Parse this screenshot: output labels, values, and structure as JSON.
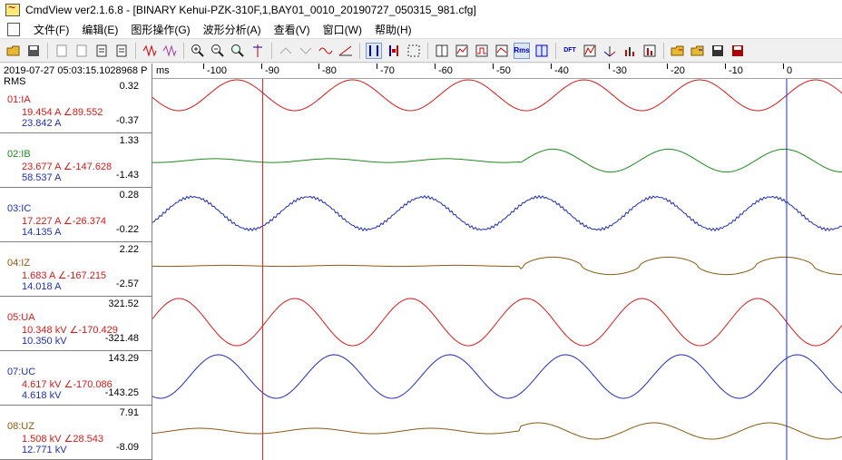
{
  "window": {
    "title": "CmdView ver2.1.6.8 - [BINARY Kehui-PZK-310F,1,BAY01_0010_20190727_050315_981.cfg]"
  },
  "menu": [
    "文件(F)",
    "编辑(E)",
    "图形操作(G)",
    "波形分析(A)",
    "查看(V)",
    "窗口(W)",
    "帮助(H)"
  ],
  "toolbar": {
    "icons": [
      "open-icon",
      "save-icon",
      "doc1-icon",
      "doc2-icon",
      "doc3-icon",
      "doc4-icon",
      "zigzag-red-icon",
      "zigzag-purple-icon",
      "zigzag-blue-icon",
      "zigzag-orange-icon",
      "zoom-in-icon",
      "zoom-out-icon",
      "zoom-fit-icon",
      "cursor-icon",
      "up-icon",
      "down-icon",
      "wave-icon",
      "ramp-icon",
      "marker-icon",
      "marker-active-icon",
      "select-box-icon",
      "grid-icon",
      "chart-icon",
      "pulse-icon",
      "chart2-icon",
      "rms-icon",
      "compare-icon",
      "dft-icon",
      "spectrum-icon",
      "vector-icon",
      "bar-icon",
      "harmonic-icon",
      "open2-icon",
      "open3-icon",
      "save2-icon",
      "save3-icon"
    ],
    "rms_text": "Rms",
    "dft_text": "DFT"
  },
  "left": {
    "timestamp": "2019-07-27 05:03:15.1028968 P",
    "mode": "RMS",
    "channels": [
      {
        "name": "01:IA",
        "v1": "19.454 A ∠89.552",
        "v2": "23.842 A",
        "max": "0.32",
        "min": "-0.37",
        "color": "#d01c1c"
      },
      {
        "name": "02:IB",
        "v1": "23.677 A ∠-147.628",
        "v2": "58.537 A",
        "max": "1.33",
        "min": "-1.43",
        "color": "#1f8a1f"
      },
      {
        "name": "03:IC",
        "v1": "17.227 A ∠-26.374",
        "v2": "14.135 A",
        "max": "0.28",
        "min": "-0.22",
        "color": "#1f2fb5"
      },
      {
        "name": "04:IZ",
        "v1": "1.683 A ∠-167.215",
        "v2": "14.018 A",
        "max": "2.22",
        "min": "-2.57",
        "color": "#8a5a14"
      },
      {
        "name": "05:UA",
        "v1": "10.348 kV ∠-170.429",
        "v2": "10.350 kV",
        "max": "321.52",
        "min": "-321.48",
        "color": "#d01c1c"
      },
      {
        "name": "07:UC",
        "v1": "4.617 kV ∠-170.086",
        "v2": "4.618 kV",
        "max": "143.29",
        "min": "-143.25",
        "color": "#1f2fb5"
      },
      {
        "name": "08:UZ",
        "v1": "1.508 kV ∠28.543",
        "v2": "12.771 kV",
        "max": "7.91",
        "min": "-8.09",
        "color": "#8a5a14"
      }
    ]
  },
  "ruler": {
    "unit": "ms",
    "ticks": [
      "-100",
      "-90",
      "-80",
      "-70",
      "-60",
      "-50",
      "-40",
      "-30",
      "-20",
      "-10",
      "0"
    ]
  },
  "cursors": {
    "red_ms": -90.5,
    "blue_ms": 0,
    "red_color": "#d01c1c",
    "blue_color": "#1f2fb5"
  }
}
